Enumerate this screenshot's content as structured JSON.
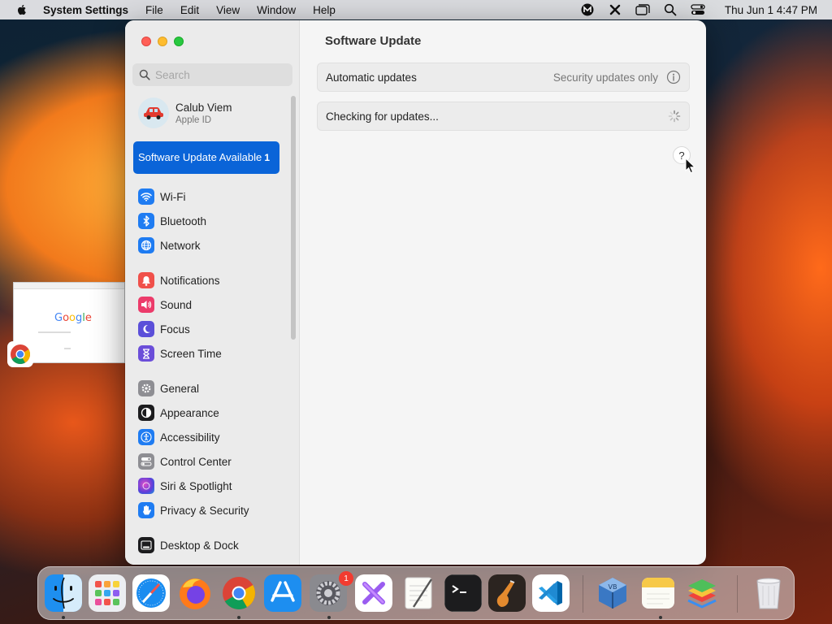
{
  "menubar": {
    "app_name": "System Settings",
    "menus": [
      "File",
      "Edit",
      "View",
      "Window",
      "Help"
    ],
    "status_icons": [
      "mailplane-icon",
      "x-tool-icon",
      "window-switch-icon",
      "search-icon",
      "control-center-icon"
    ],
    "clock": "Thu Jun 1  4:47 PM"
  },
  "sidebar": {
    "search_placeholder": "Search",
    "account": {
      "name": "Calub Viem",
      "subtitle": "Apple ID"
    },
    "update_item": {
      "label": "Software Update Available",
      "count": "1"
    },
    "group1": [
      {
        "label": "Wi-Fi",
        "icon": "wifi-icon",
        "color": "#1f7cf2"
      },
      {
        "label": "Bluetooth",
        "icon": "bluetooth-icon",
        "color": "#1f7cf2"
      },
      {
        "label": "Network",
        "icon": "globe-icon",
        "color": "#1f7cf2"
      }
    ],
    "group2": [
      {
        "label": "Notifications",
        "icon": "bell-icon",
        "color": "#f0504a"
      },
      {
        "label": "Sound",
        "icon": "speaker-icon",
        "color": "#ec3b6a"
      },
      {
        "label": "Focus",
        "icon": "moon-icon",
        "color": "#5b4fd9"
      },
      {
        "label": "Screen Time",
        "icon": "hourglass-icon",
        "color": "#6b4ed9"
      }
    ],
    "group3": [
      {
        "label": "General",
        "icon": "gear-icon",
        "color": "#8e8e93"
      },
      {
        "label": "Appearance",
        "icon": "appearance-icon",
        "color": "#1c1c1e"
      },
      {
        "label": "Accessibility",
        "icon": "accessibility-icon",
        "color": "#1f7cf2"
      },
      {
        "label": "Control Center",
        "icon": "toggles-icon",
        "color": "#8e8e93"
      },
      {
        "label": "Siri & Spotlight",
        "icon": "siri-icon",
        "color": "#b04be0"
      },
      {
        "label": "Privacy & Security",
        "icon": "hand-icon",
        "color": "#1f7cf2"
      }
    ],
    "group4": [
      {
        "label": "Desktop & Dock",
        "icon": "dock-icon",
        "color": "#1c1c1e"
      }
    ]
  },
  "main": {
    "title": "Software Update",
    "auto_updates": {
      "label": "Automatic updates",
      "value": "Security updates only"
    },
    "status": {
      "label": "Checking for updates..."
    },
    "help": "?"
  },
  "thumbnail": {
    "logo_text": "Google"
  },
  "dock": {
    "apps": [
      "Finder",
      "Launchpad",
      "Safari",
      "Firefox",
      "Google Chrome",
      "App Store",
      "System Settings",
      "Xcode Instruments",
      "TextEdit",
      "Terminal",
      "GarageBand",
      "Visual Studio Code",
      "VirtualBox",
      "Notes",
      "BlueStacks",
      "Trash"
    ],
    "system_settings_badge": "1"
  }
}
